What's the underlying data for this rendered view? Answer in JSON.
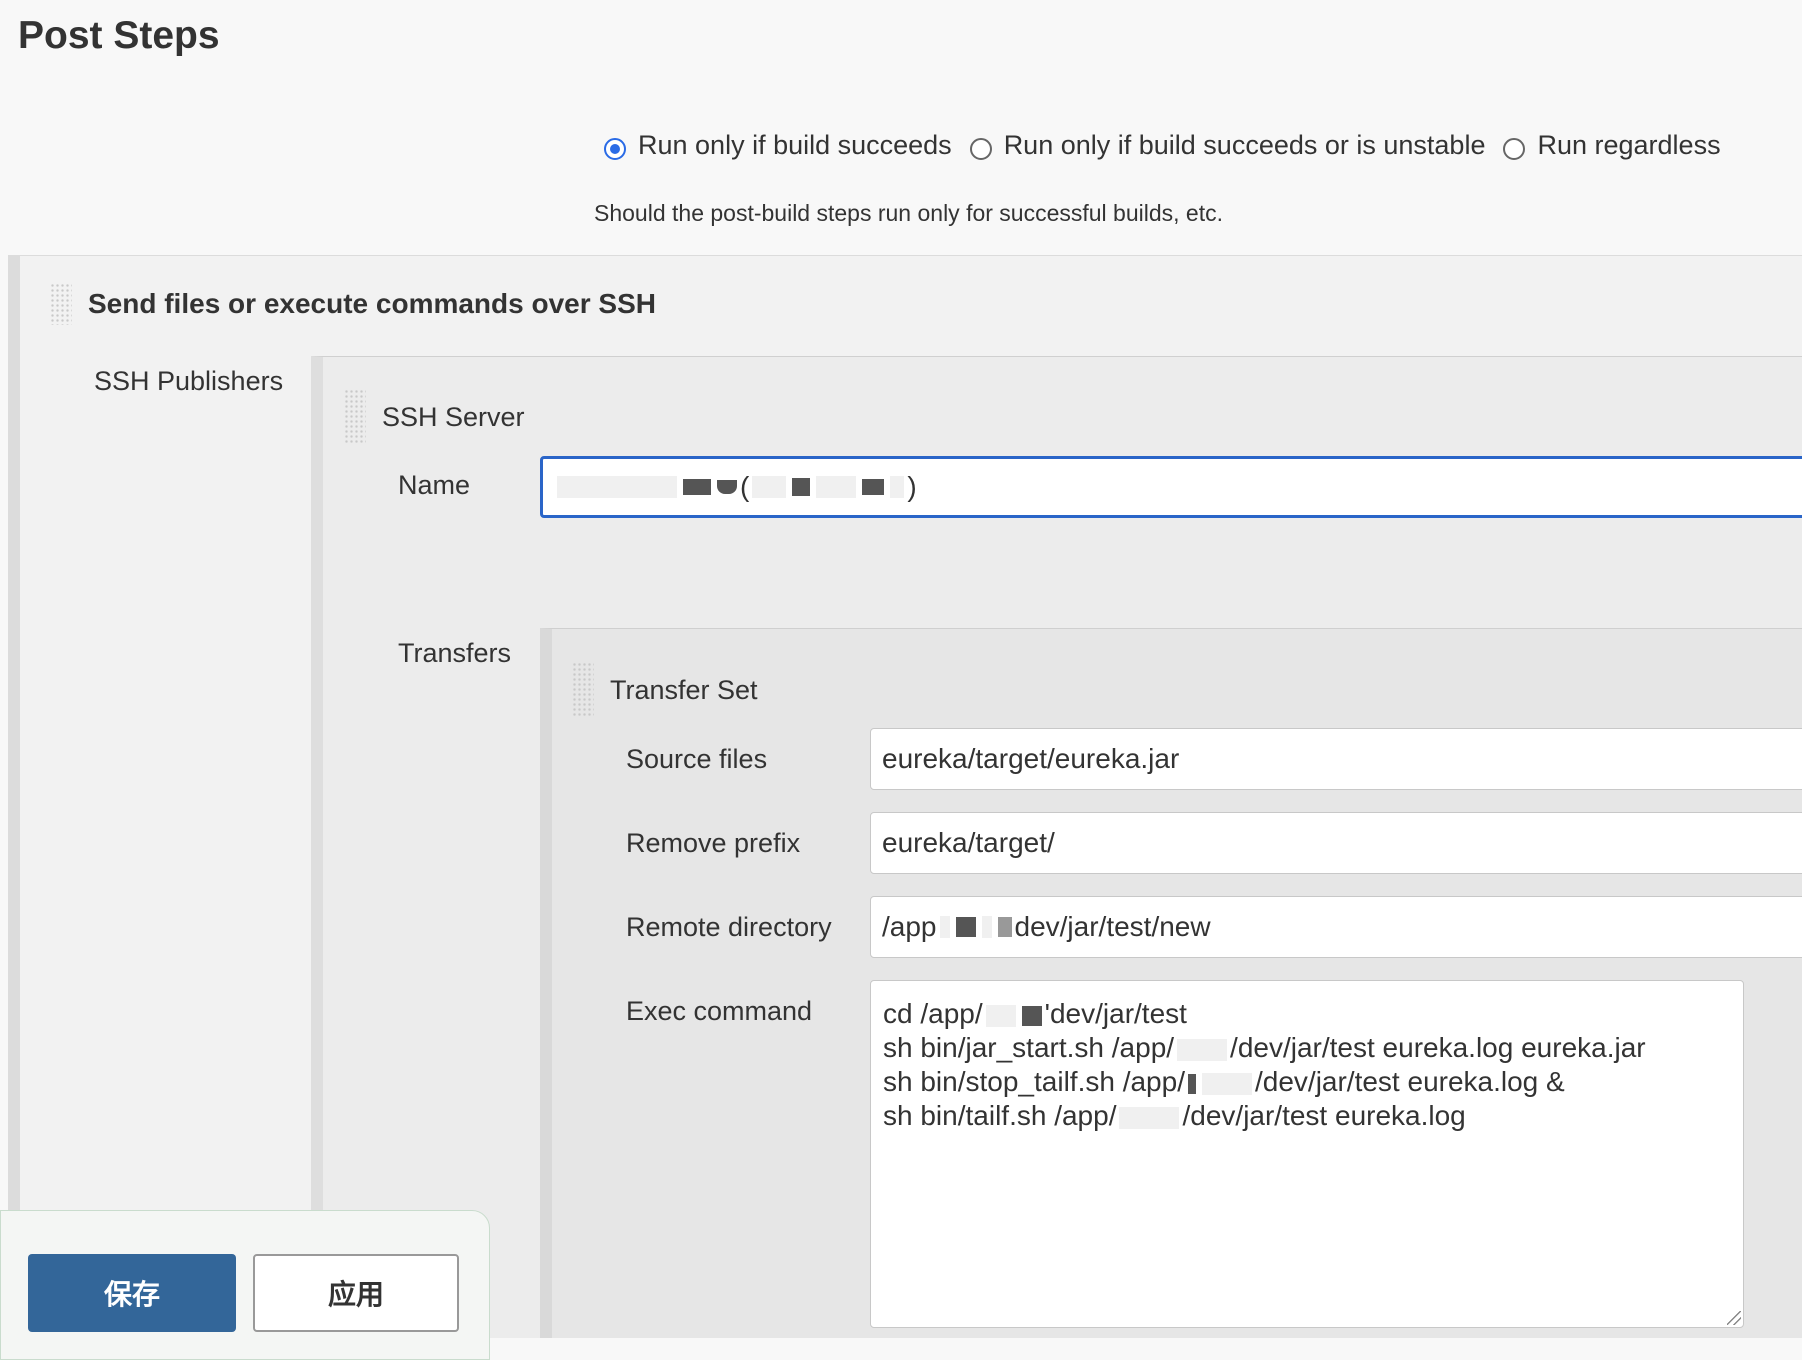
{
  "section": {
    "title": "Post Steps",
    "run_condition": {
      "options": [
        {
          "label": "Run only if build succeeds",
          "selected": true
        },
        {
          "label": "Run only if build succeeds or is unstable",
          "selected": false
        },
        {
          "label": "Run regardless",
          "selected": false
        }
      ],
      "help": "Should the post-build steps run only for successful builds, etc."
    }
  },
  "ssh_step": {
    "title": "Send files or execute commands over SSH",
    "publishers_label": "SSH Publishers",
    "server": {
      "title": "SSH Server",
      "name_label": "Name",
      "name_prefix": "(",
      "name_suffix": ")"
    },
    "transfers_label": "Transfers",
    "transfer_set": {
      "title": "Transfer Set",
      "source_files_label": "Source files",
      "source_files_value": "eureka/target/eureka.jar",
      "remove_prefix_label": "Remove prefix",
      "remove_prefix_value": "eureka/target/",
      "remote_directory_label": "Remote directory",
      "remote_directory_prefix": "/app",
      "remote_directory_suffix": "dev/jar/test/new",
      "exec_command_label": "Exec command",
      "exec_lines": [
        {
          "before": "cd /app/",
          "after": "'dev/jar/test"
        },
        {
          "before": "sh bin/jar_start.sh /app/",
          "after": "/dev/jar/test eureka.log eureka.jar"
        },
        {
          "before": "sh bin/stop_tailf.sh /app/",
          "after": "/dev/jar/test eureka.log &"
        },
        {
          "before": "sh bin/tailf.sh /app/",
          "after": "/dev/jar/test eureka.log"
        }
      ]
    }
  },
  "footer": {
    "save_label": "保存",
    "apply_label": "应用"
  },
  "colors": {
    "accent": "#2a65c8",
    "save_button": "#336699"
  }
}
